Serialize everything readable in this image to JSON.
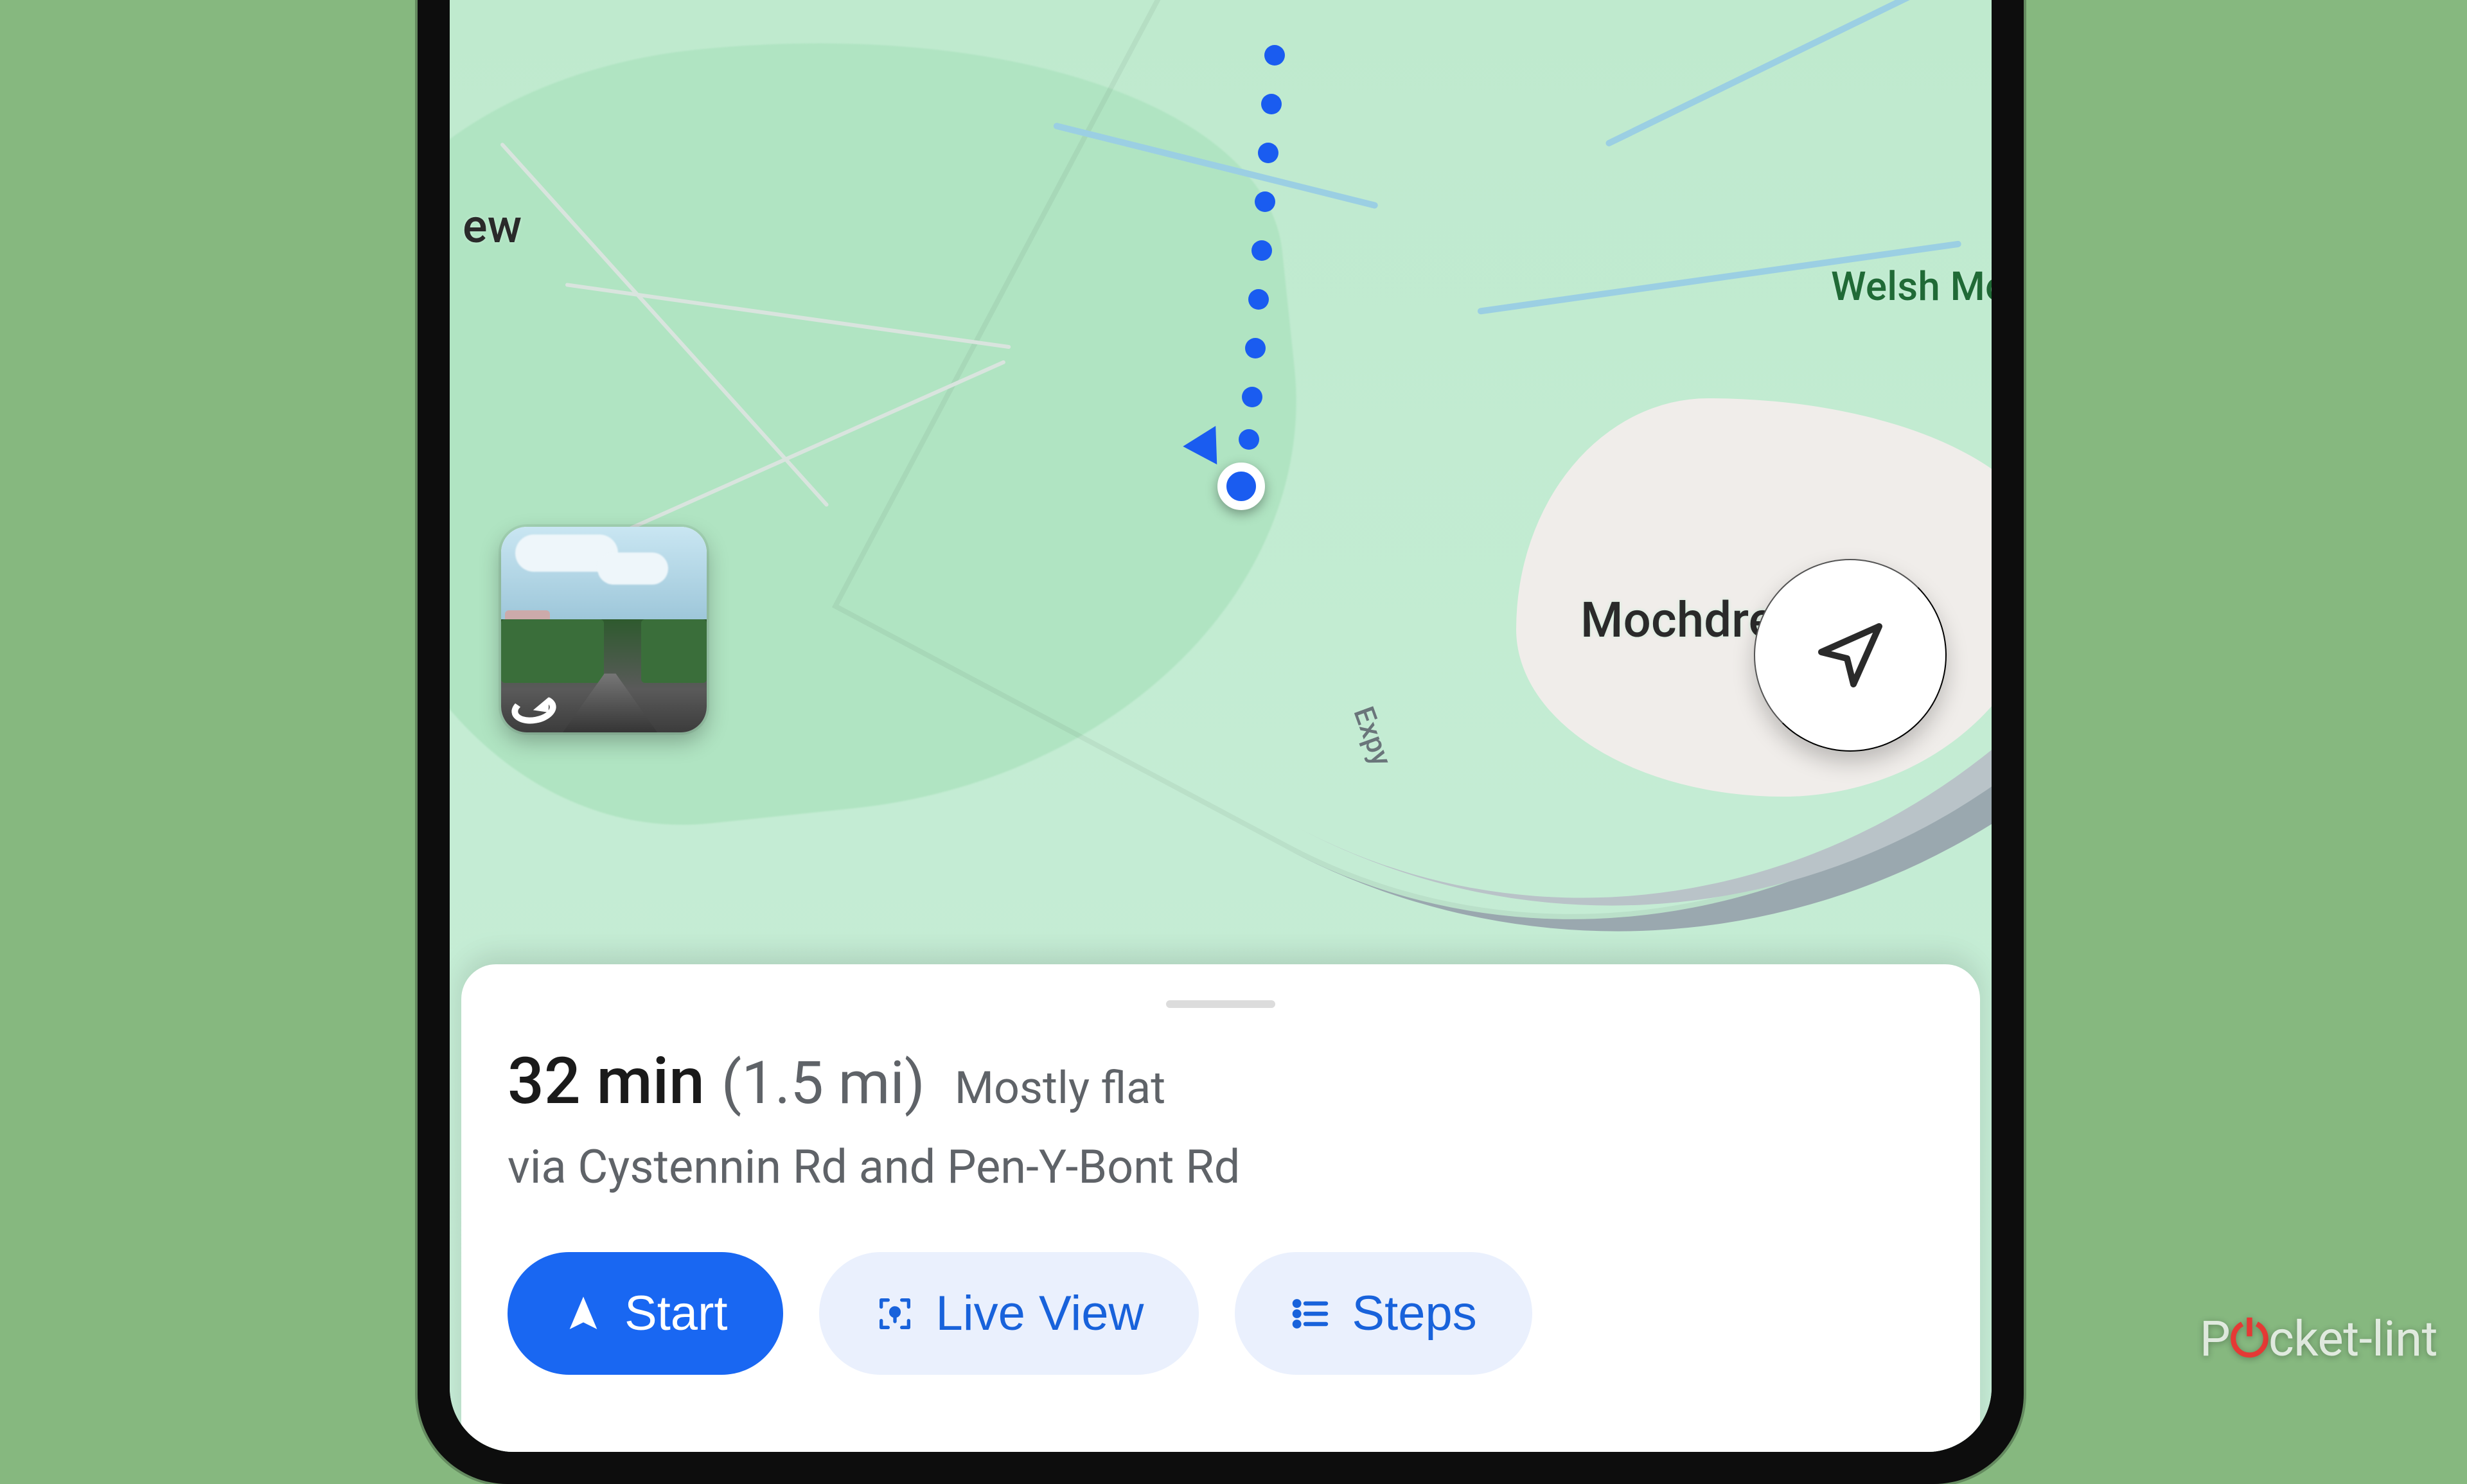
{
  "map": {
    "labels": {
      "left_partial": "ew",
      "town": "Mochdre",
      "poi": "Welsh Mou",
      "road": "Expy"
    }
  },
  "route": {
    "duration": "32 min",
    "distance": "(1.5 mi)",
    "terrain": "Mostly flat",
    "via": "via Cystennin Rd and Pen-Y-Bont Rd"
  },
  "actions": {
    "start": "Start",
    "live_view": "Live View",
    "steps": "Steps"
  },
  "watermark": {
    "a": "P",
    "b": "cket",
    "c": "-lint"
  }
}
